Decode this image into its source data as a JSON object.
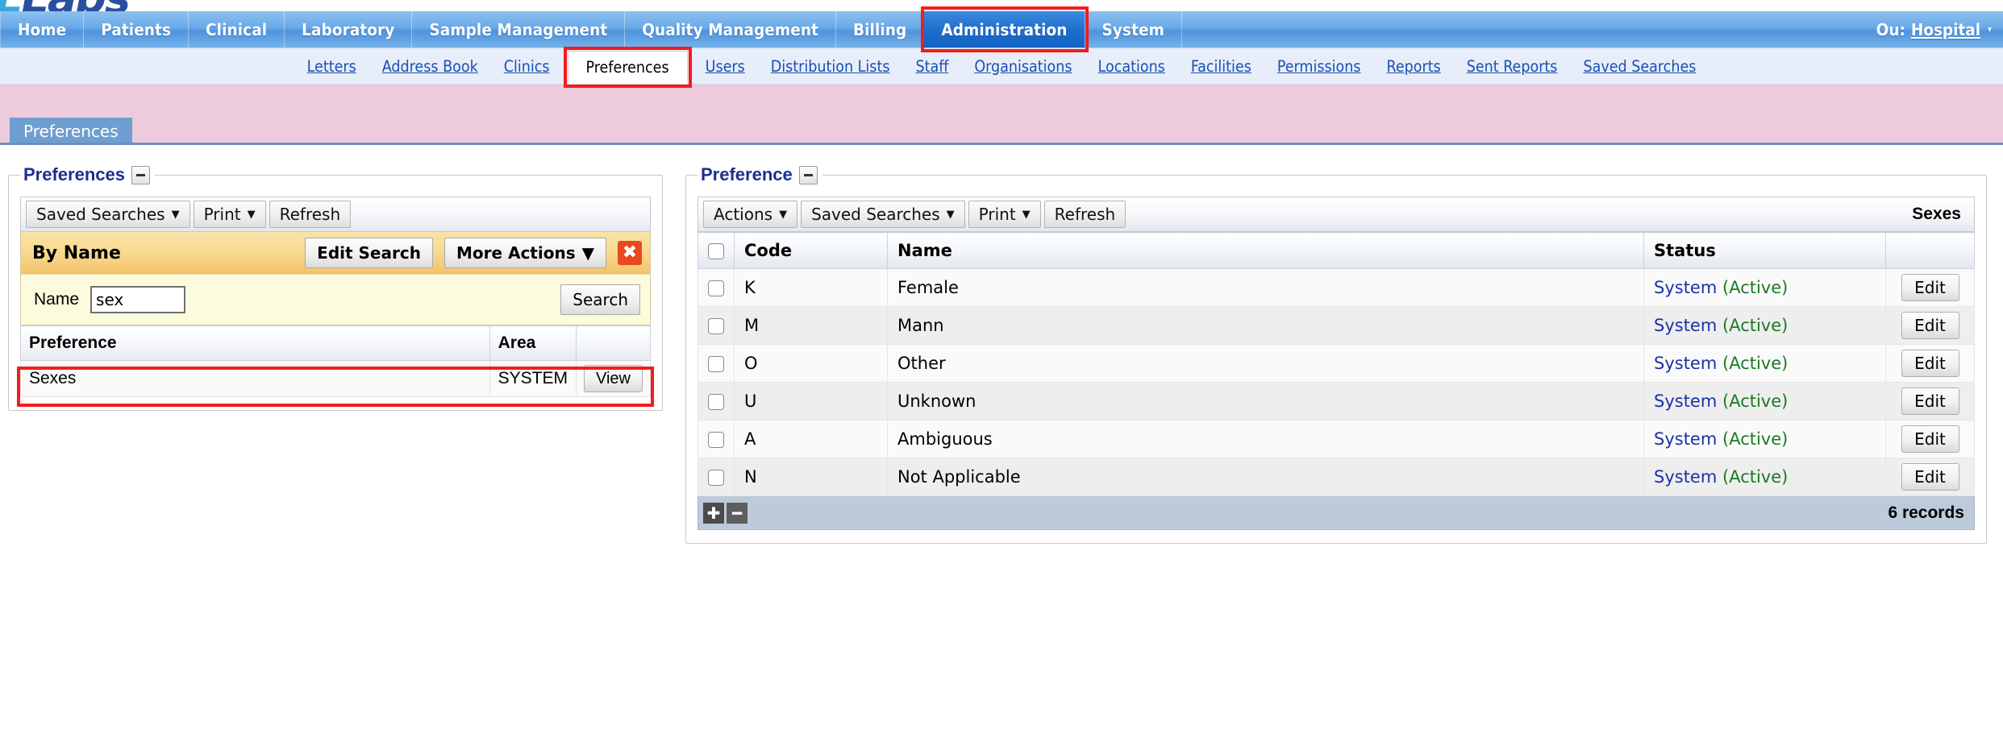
{
  "brand": {
    "logo_text": "Labs"
  },
  "mainnav": {
    "items": [
      {
        "label": "Home",
        "active": false
      },
      {
        "label": "Patients",
        "active": false
      },
      {
        "label": "Clinical",
        "active": false
      },
      {
        "label": "Laboratory",
        "active": false
      },
      {
        "label": "Sample Management",
        "active": false
      },
      {
        "label": "Quality Management",
        "active": false
      },
      {
        "label": "Billing",
        "active": false
      },
      {
        "label": "Administration",
        "active": true
      },
      {
        "label": "System",
        "active": false
      }
    ],
    "user": {
      "prefix": "Ou:",
      "org": "Hospital",
      "caret": "▾"
    }
  },
  "subnav": {
    "items": [
      {
        "label": "Letters",
        "active": false
      },
      {
        "label": "Address Book",
        "active": false
      },
      {
        "label": "Clinics",
        "active": false
      },
      {
        "label": "Preferences",
        "active": true
      },
      {
        "label": "Users",
        "active": false
      },
      {
        "label": "Distribution Lists",
        "active": false
      },
      {
        "label": "Staff",
        "active": false
      },
      {
        "label": "Organisations",
        "active": false
      },
      {
        "label": "Locations",
        "active": false
      },
      {
        "label": "Facilities",
        "active": false
      },
      {
        "label": "Permissions",
        "active": false
      },
      {
        "label": "Reports",
        "active": false
      },
      {
        "label": "Sent Reports",
        "active": false
      },
      {
        "label": "Saved Searches",
        "active": false
      }
    ]
  },
  "banner": {
    "tab_label": "Preferences"
  },
  "left_panel": {
    "legend": "Preferences",
    "toolbar": [
      {
        "label": "Saved Searches",
        "caret": "▼"
      },
      {
        "label": "Print",
        "caret": "▼"
      },
      {
        "label": "Refresh",
        "caret": ""
      }
    ],
    "search": {
      "title": "By Name",
      "edit_search_label": "Edit Search",
      "more_actions_label": "More Actions",
      "more_actions_caret": "▼",
      "close_icon": "✖",
      "name_label": "Name",
      "name_value": "sex",
      "name_placeholder": "",
      "search_button": "Search"
    },
    "results": {
      "columns": [
        "Preference",
        "Area",
        ""
      ],
      "rows": [
        {
          "preference": "Sexes",
          "area": "SYSTEM",
          "action": "View"
        }
      ]
    }
  },
  "right_panel": {
    "legend": "Preference",
    "toolbar": [
      {
        "label": "Actions",
        "caret": "▼"
      },
      {
        "label": "Saved Searches",
        "caret": "▼"
      },
      {
        "label": "Print",
        "caret": "▼"
      },
      {
        "label": "Refresh",
        "caret": ""
      }
    ],
    "toolbar_title": "Sexes",
    "table": {
      "columns": [
        "",
        "Code",
        "Name",
        "Status",
        ""
      ],
      "rows": [
        {
          "code": "K",
          "name": "Female",
          "status_system": "System",
          "status_state": "(Active)",
          "action": "Edit"
        },
        {
          "code": "M",
          "name": "Mann",
          "status_system": "System",
          "status_state": "(Active)",
          "action": "Edit"
        },
        {
          "code": "O",
          "name": "Other",
          "status_system": "System",
          "status_state": "(Active)",
          "action": "Edit"
        },
        {
          "code": "U",
          "name": "Unknown",
          "status_system": "System",
          "status_state": "(Active)",
          "action": "Edit"
        },
        {
          "code": "A",
          "name": "Ambiguous",
          "status_system": "System",
          "status_state": "(Active)",
          "action": "Edit"
        },
        {
          "code": "N",
          "name": "Not Applicable",
          "status_system": "System",
          "status_state": "(Active)",
          "action": "Edit"
        }
      ],
      "footer": {
        "add_icon": "✚",
        "remove_icon": "━",
        "record_count": "6 records"
      }
    }
  },
  "colors": {
    "nav_active": "#1f6fcd",
    "annotation": "#f41c1c",
    "banner_pink": "#eecbdc",
    "status_system": "#1d31a8",
    "status_active": "#1a7a24",
    "legend_navy": "#1c2f8f"
  }
}
